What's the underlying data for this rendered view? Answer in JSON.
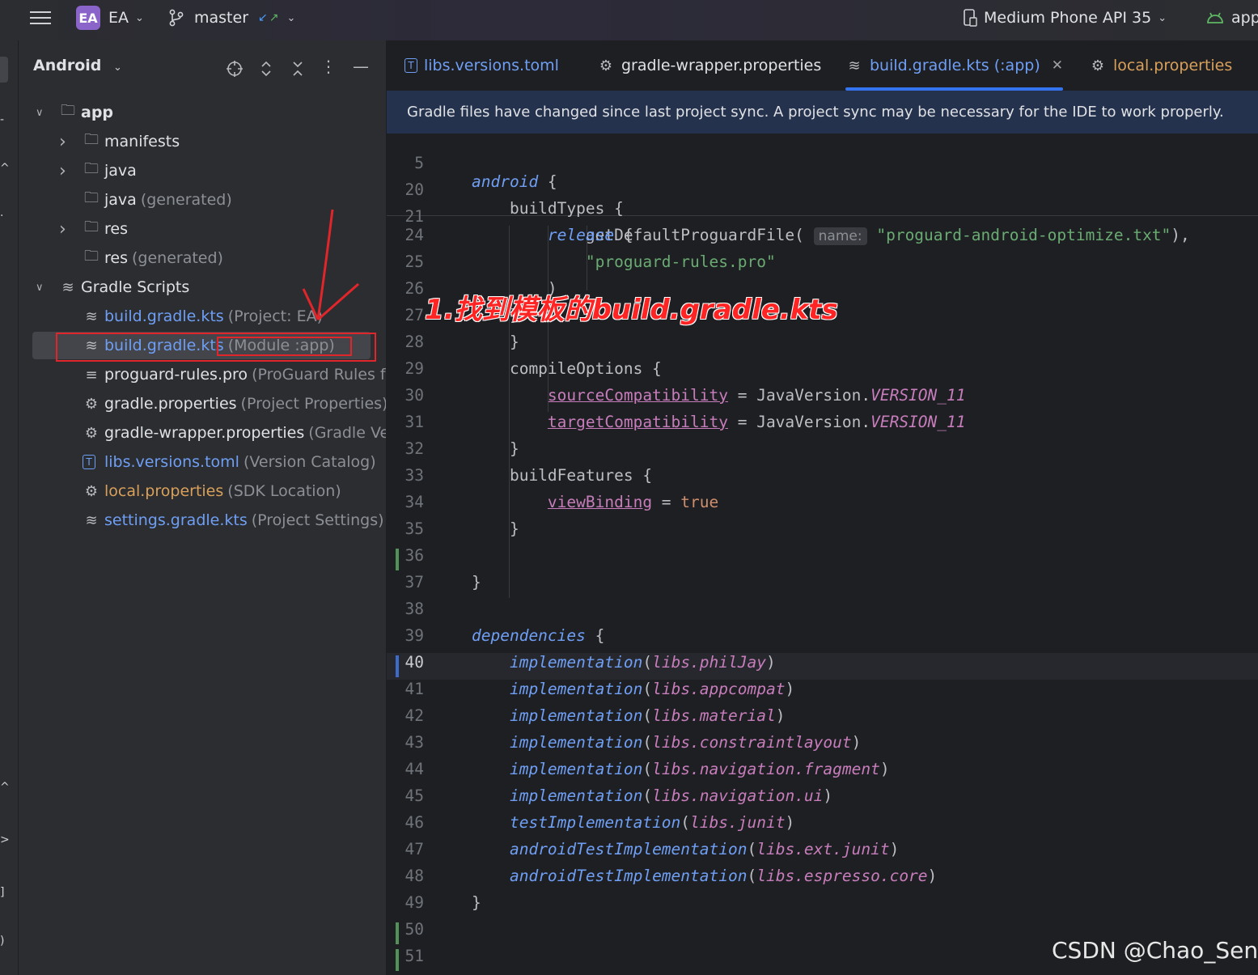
{
  "titlebar": {
    "project_badge": "EA",
    "project_name": "EA",
    "branch": "master",
    "device": "Medium Phone API 35",
    "run_config": "app"
  },
  "project_panel": {
    "view_mode": "Android",
    "tree": [
      {
        "label": "app",
        "hint": "",
        "color": "#dfe1e5",
        "icon": "module-folder-icon"
      },
      {
        "label": "manifests",
        "hint": "",
        "color": "#dfe1e5",
        "icon": "folder-icon"
      },
      {
        "label": "java",
        "hint": "",
        "color": "#dfe1e5",
        "icon": "folder-icon"
      },
      {
        "label": "java",
        "hint": "(generated)",
        "color": "#dfe1e5",
        "icon": "generated-folder-icon"
      },
      {
        "label": "res",
        "hint": "",
        "color": "#dfe1e5",
        "icon": "res-folder-icon"
      },
      {
        "label": "res",
        "hint": "(generated)",
        "color": "#dfe1e5",
        "icon": "res-folder-icon"
      },
      {
        "label": "Gradle Scripts",
        "hint": "",
        "color": "#dfe1e5",
        "icon": "gradle-icon"
      },
      {
        "label": "build.gradle.kts",
        "hint": "(Project: EA)",
        "color": "#6f9ff5",
        "icon": "gradle-kts-icon"
      },
      {
        "label": "build.gradle.kts",
        "hint": "(Module :app)",
        "color": "#6f9ff5",
        "icon": "gradle-kts-icon"
      },
      {
        "label": "proguard-rules.pro",
        "hint": "(ProGuard Rules for \"",
        "color": "#dfe1e5",
        "icon": "text-file-icon"
      },
      {
        "label": "gradle.properties",
        "hint": "(Project Properties)",
        "color": "#dfe1e5",
        "icon": "properties-icon"
      },
      {
        "label": "gradle-wrapper.properties",
        "hint": "(Gradle Versio",
        "color": "#dfe1e5",
        "icon": "properties-icon"
      },
      {
        "label": "libs.versions.toml",
        "hint": "(Version Catalog)",
        "color": "#6f9ff5",
        "icon": "toml-icon"
      },
      {
        "label": "local.properties",
        "hint": "(SDK Location)",
        "color": "#d9a05b",
        "icon": "properties-icon"
      },
      {
        "label": "settings.gradle.kts",
        "hint": "(Project Settings)",
        "color": "#6f9ff5",
        "icon": "gradle-kts-icon"
      }
    ]
  },
  "editor": {
    "tabs": [
      {
        "label": "libs.versions.toml",
        "icon": "toml-icon"
      },
      {
        "label": "gradle-wrapper.properties",
        "icon": "properties-icon"
      },
      {
        "label": "build.gradle.kts (:app)",
        "icon": "gradle-kts-icon"
      },
      {
        "label": "local.properties",
        "icon": "properties-icon"
      }
    ],
    "active_tab": "build.gradle.kts (:app)",
    "notification": "Gradle files have changed since last project sync. A project sync may be necessary for the IDE to work properly.",
    "sticky_lines": [
      {
        "n": "5",
        "code": "android {"
      },
      {
        "n": "20",
        "code": "    buildTypes {"
      },
      {
        "n": "21",
        "code": "        release {"
      }
    ],
    "lines": [
      {
        "n": "24",
        "code": "            getDefaultProguardFile( name: \"proguard-android-optimize.txt\"),"
      },
      {
        "n": "25",
        "code": "            \"proguard-rules.pro\""
      },
      {
        "n": "26",
        "code": "        )"
      },
      {
        "n": "27",
        "code": "    }"
      },
      {
        "n": "28",
        "code": "    }"
      },
      {
        "n": "29",
        "code": "    compileOptions {"
      },
      {
        "n": "30",
        "code": "        sourceCompatibility = JavaVersion.VERSION_11"
      },
      {
        "n": "31",
        "code": "        targetCompatibility = JavaVersion.VERSION_11"
      },
      {
        "n": "32",
        "code": "    }"
      },
      {
        "n": "33",
        "code": "    buildFeatures {"
      },
      {
        "n": "34",
        "code": "        viewBinding = true"
      },
      {
        "n": "35",
        "code": "    }"
      },
      {
        "n": "36",
        "code": ""
      },
      {
        "n": "37",
        "code": "}"
      },
      {
        "n": "38",
        "code": ""
      },
      {
        "n": "39",
        "code": "dependencies {"
      },
      {
        "n": "40",
        "code": "    implementation(libs.philJay)"
      },
      {
        "n": "41",
        "code": "    implementation(libs.appcompat)"
      },
      {
        "n": "42",
        "code": "    implementation(libs.material)"
      },
      {
        "n": "43",
        "code": "    implementation(libs.constraintlayout)"
      },
      {
        "n": "44",
        "code": "    implementation(libs.navigation.fragment)"
      },
      {
        "n": "45",
        "code": "    implementation(libs.navigation.ui)"
      },
      {
        "n": "46",
        "code": "    testImplementation(libs.junit)"
      },
      {
        "n": "47",
        "code": "    androidTestImplementation(libs.ext.junit)"
      },
      {
        "n": "48",
        "code": "    androidTestImplementation(libs.espresso.core)"
      },
      {
        "n": "49",
        "code": "}"
      },
      {
        "n": "50",
        "code": ""
      },
      {
        "n": "51",
        "code": ""
      }
    ],
    "current_line": "40"
  },
  "annotation_text": "1.找到模板的build.gradle.kts",
  "watermark": "CSDN @Chao_Sen"
}
